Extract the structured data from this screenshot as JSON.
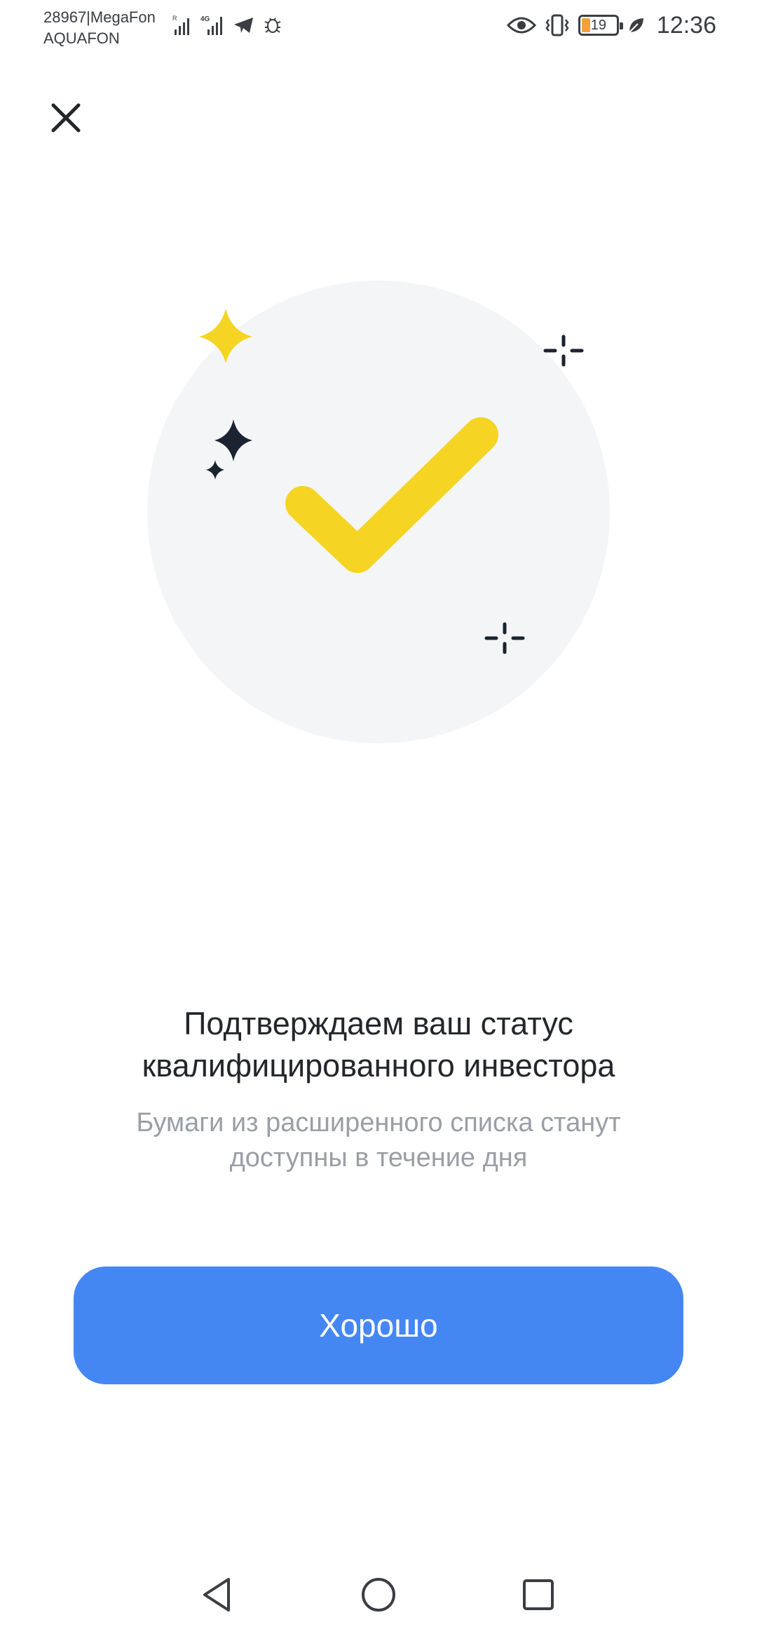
{
  "status_bar": {
    "carrier_line1": "28967|MegaFon",
    "carrier_line2": "AQUAFON",
    "time": "12:36",
    "battery_level": "19",
    "icons": [
      "signal-r-icon",
      "signal-4g-icon",
      "telegram-icon",
      "bug-icon",
      "eye-icon",
      "vibrate-icon",
      "battery-icon",
      "leaf-icon"
    ]
  },
  "header": {
    "close_icon": "close-icon"
  },
  "illustration": {
    "icon": "checkmark-icon",
    "colors": {
      "circle": "#f4f5f7",
      "check": "#f5d423",
      "sparkle_yellow": "#f5d423",
      "sparkle_dark": "#1b2230"
    }
  },
  "message": {
    "title_line1": "Подтверждаем ваш статус",
    "title_line2": "квалифицированного инвестора",
    "subtitle_line1": "Бумаги из расширенного списка станут",
    "subtitle_line2": "доступны в течение дня"
  },
  "actions": {
    "ok_label": "Хорошо",
    "ok_color": "#4487f3"
  },
  "nav_bar": {
    "items": [
      "back-icon",
      "home-icon",
      "recents-icon"
    ]
  }
}
